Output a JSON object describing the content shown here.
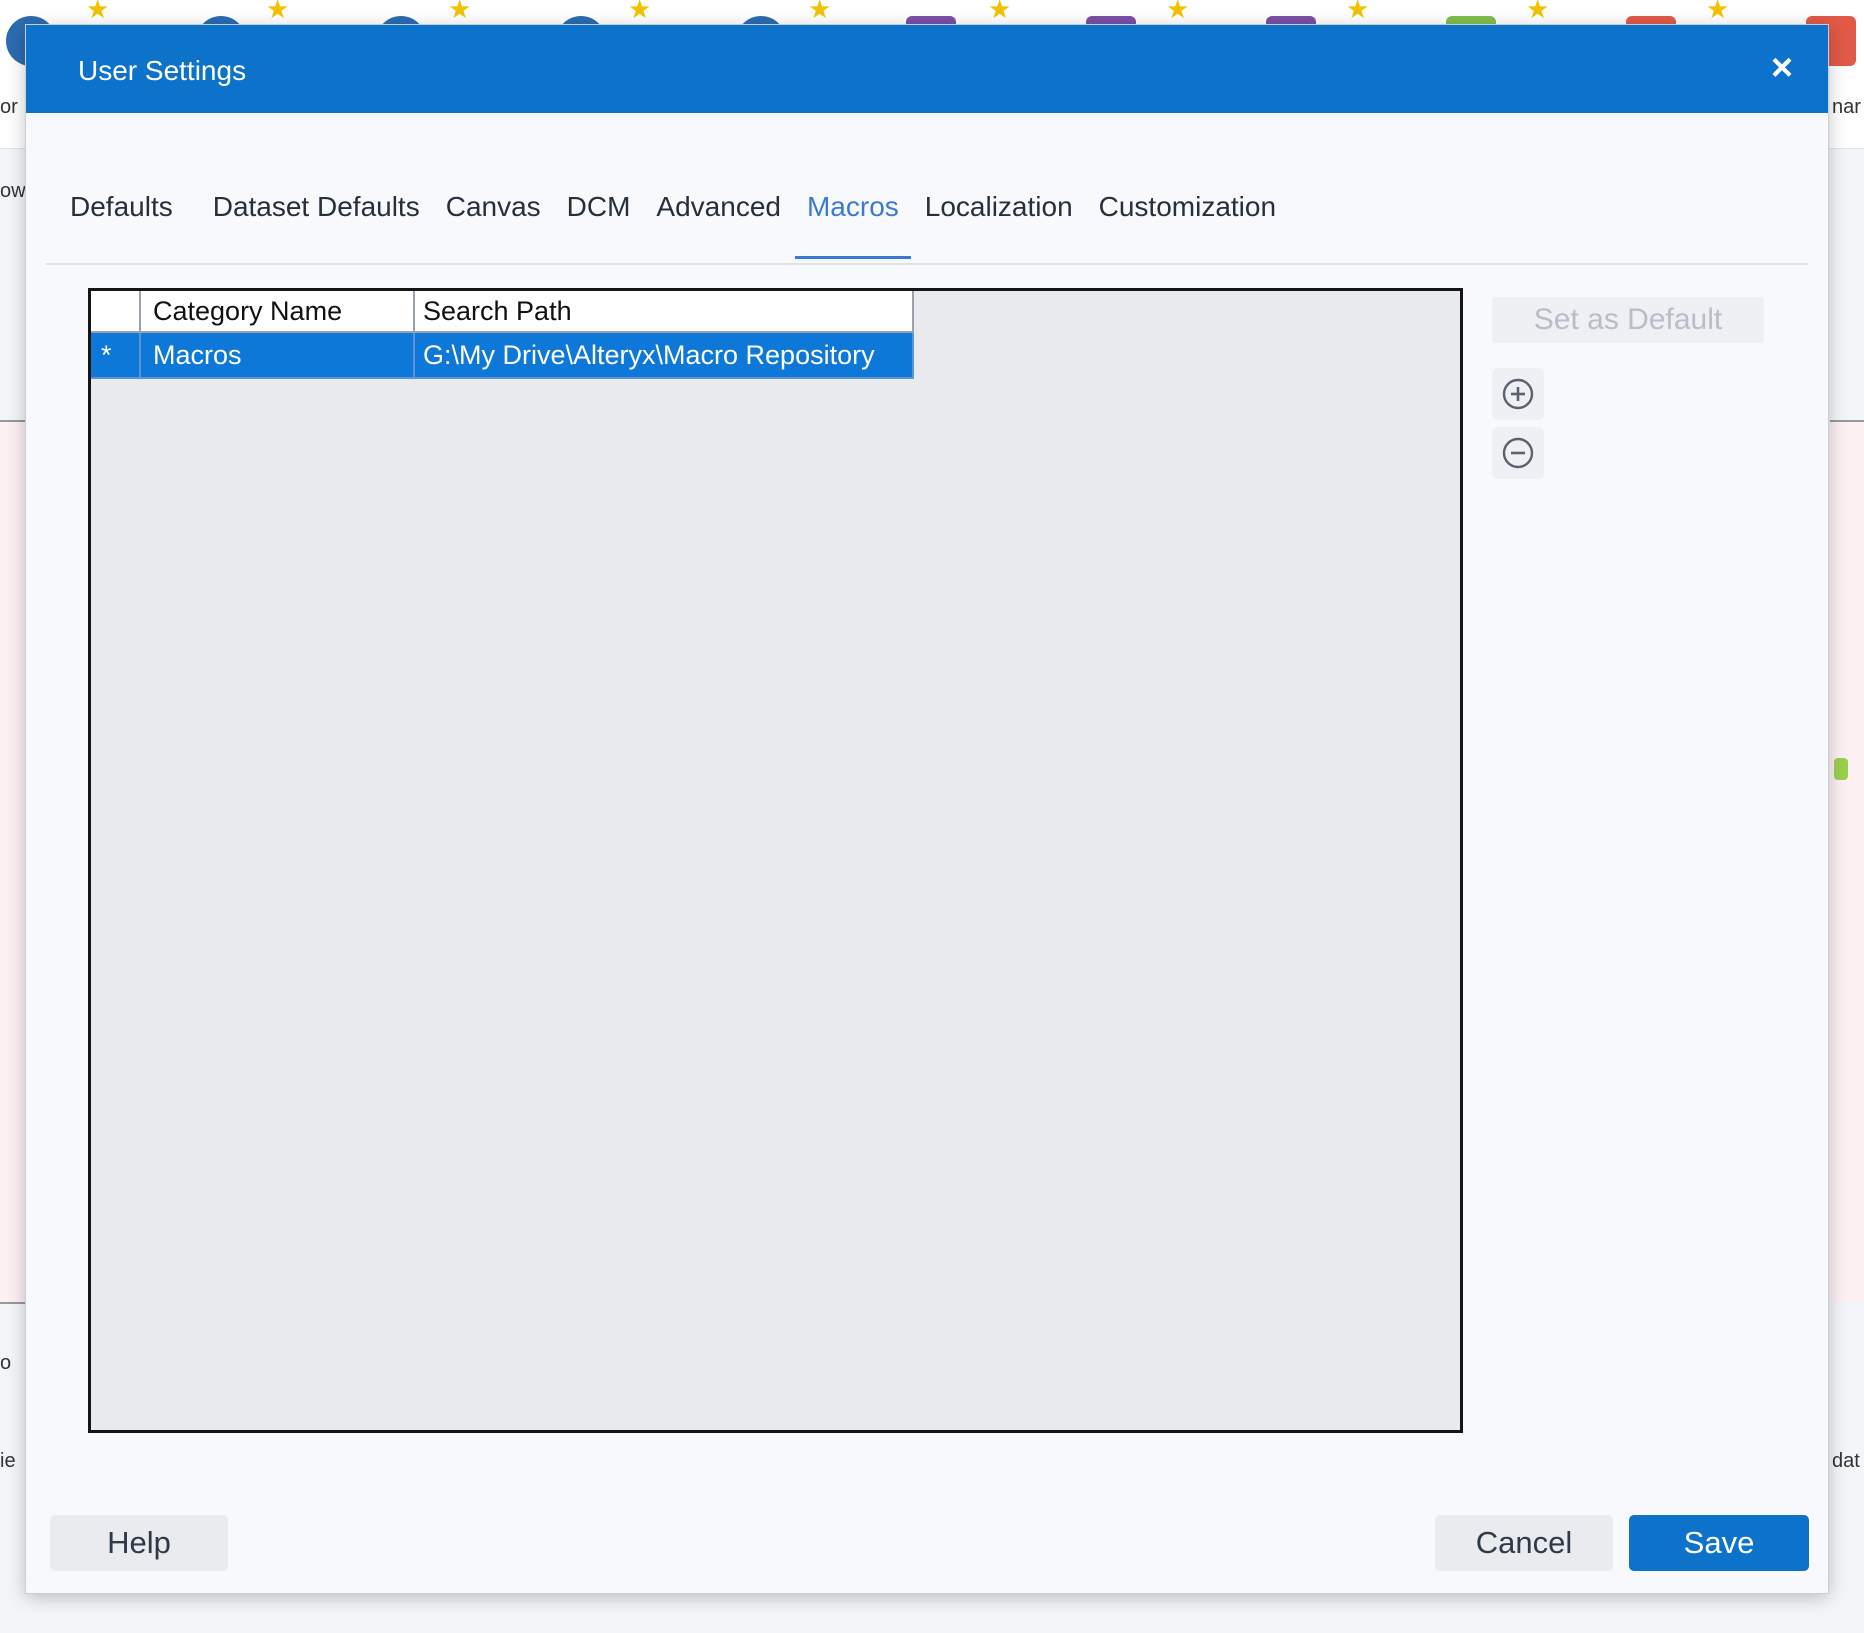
{
  "dialog": {
    "title": "User Settings",
    "close_label": "×"
  },
  "tabs": [
    {
      "label": "Defaults"
    },
    {
      "label": "Dataset Defaults"
    },
    {
      "label": "Canvas"
    },
    {
      "label": "DCM"
    },
    {
      "label": "Advanced"
    },
    {
      "label": "Macros"
    },
    {
      "label": "Localization"
    },
    {
      "label": "Customization"
    }
  ],
  "active_tab": "Macros",
  "macros_table": {
    "columns": [
      "",
      "Category Name",
      "Search Path"
    ],
    "rows": [
      {
        "marker": "*",
        "category": "Macros",
        "path": "G:\\My Drive\\Alteryx\\Macro Repository",
        "selected": true
      }
    ]
  },
  "actions": {
    "set_default_label": "Set as Default",
    "add_icon": "add-circle-icon",
    "remove_icon": "remove-circle-icon"
  },
  "footer": {
    "help_label": "Help",
    "cancel_label": "Cancel",
    "save_label": "Save"
  },
  "colors": {
    "title_bar": "#0d72c9",
    "active_tab": "#3a7ad6",
    "selected_row": "#0e78d8",
    "primary_button": "#0d72c9"
  },
  "background": {
    "labels": [
      "or",
      "ow",
      "o",
      "ie",
      "nar",
      "dat"
    ]
  }
}
